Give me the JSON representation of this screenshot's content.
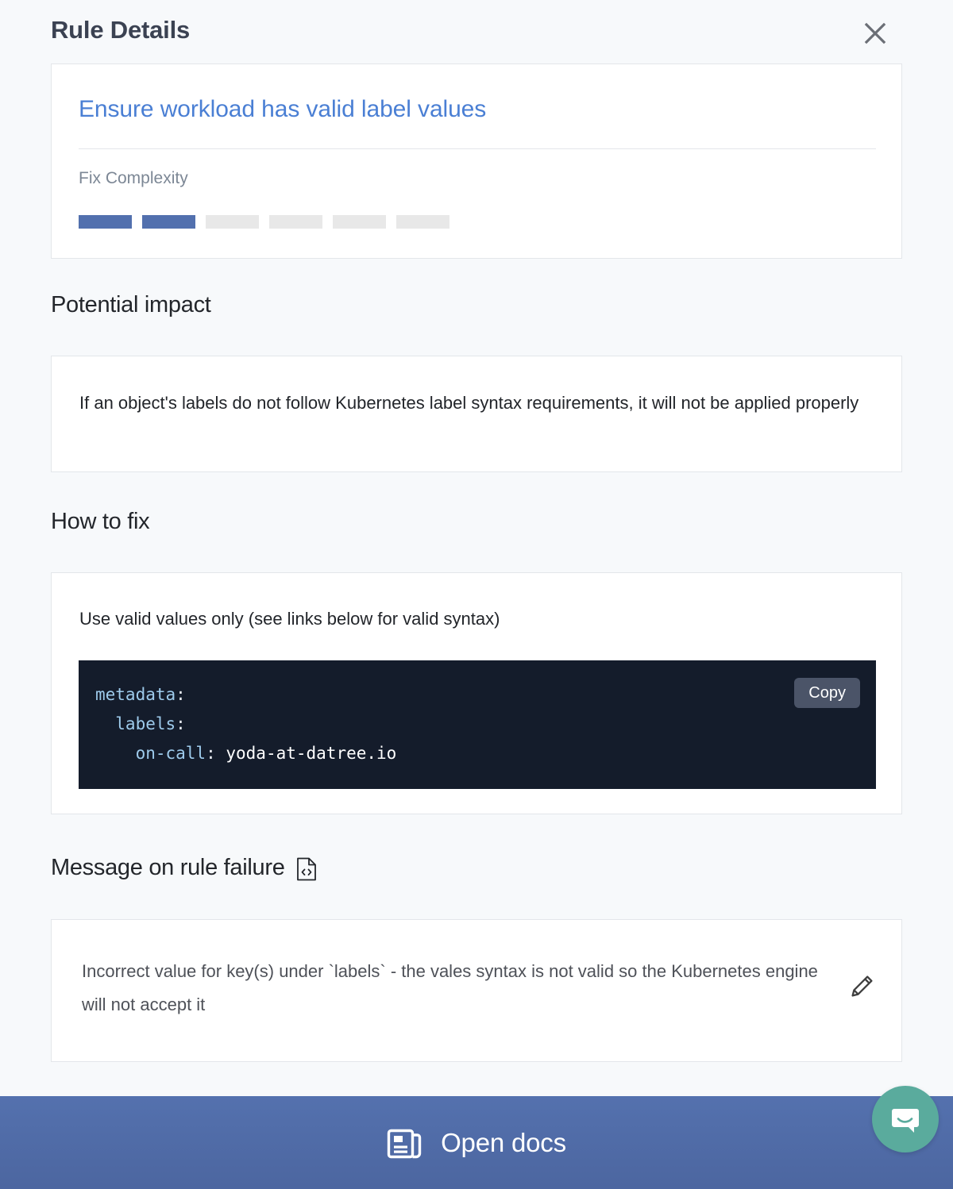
{
  "header": {
    "title": "Rule Details",
    "close_icon": "close-icon"
  },
  "rule": {
    "title": "Ensure workload has valid label values",
    "fix_complexity_label": "Fix Complexity",
    "complexity_filled": 2,
    "complexity_total": 6,
    "complexity_on_color": "#5270ae",
    "complexity_off_color": "#e8e8e8"
  },
  "sections": {
    "potential_impact": {
      "heading": "Potential impact",
      "body": "If an object's labels do not follow Kubernetes label syntax requirements, it will not be applied properly"
    },
    "how_to_fix": {
      "heading": "How to fix",
      "body": "Use valid values only (see links below for valid syntax)",
      "code": {
        "copy_label": "Copy",
        "language": "yaml",
        "lines": [
          {
            "indent": 0,
            "key": "metadata",
            "value": ""
          },
          {
            "indent": 1,
            "key": "labels",
            "value": ""
          },
          {
            "indent": 2,
            "key": "on-call",
            "value": "yoda-at-datree.io"
          }
        ],
        "plain_text": "metadata:\n  labels:\n    on-call: yoda-at-datree.io",
        "key_color": "#9ecbec",
        "value_color": "#ffffff",
        "background": "#141c2b"
      }
    },
    "message_on_rule_failure": {
      "heading": "Message on rule failure",
      "heading_icon": "file-code-icon",
      "body": "Incorrect value for key(s) under `labels` - the vales syntax is not valid so the Kubernetes engine will not accept it",
      "edit_icon": "pencil-icon"
    }
  },
  "footer": {
    "label": "Open docs",
    "icon": "docs-icon",
    "background_color": "#5471ae"
  },
  "chat_launcher": {
    "icon": "chat-bubble-icon",
    "background_color": "#5aab9d"
  }
}
